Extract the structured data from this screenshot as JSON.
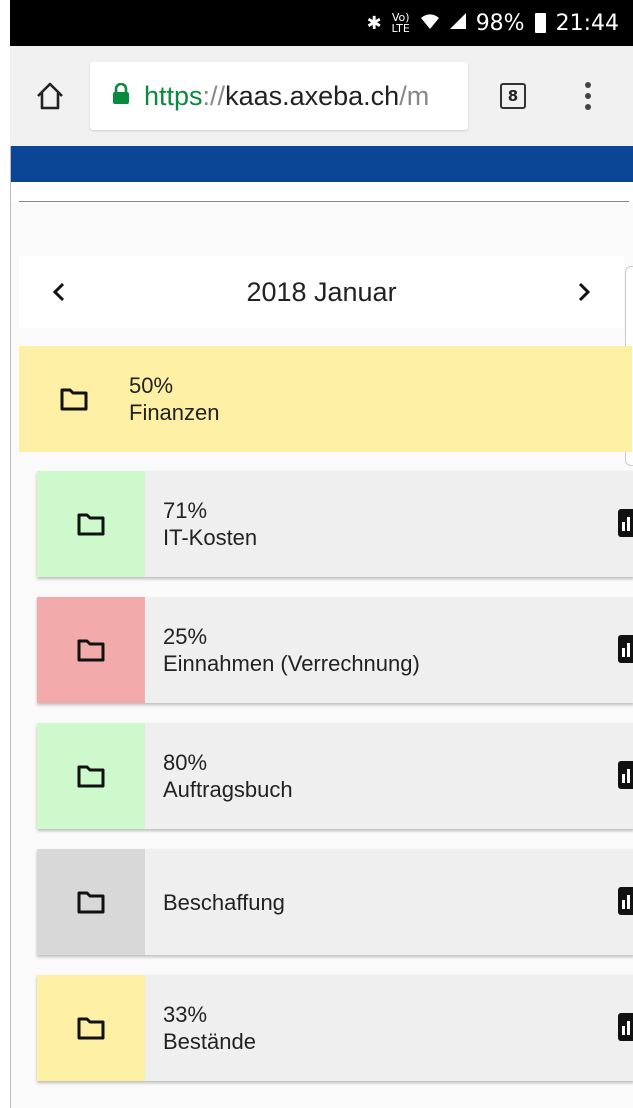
{
  "status_bar": {
    "bluetooth_icon": "bluetooth-icon",
    "volte": "Vo) LTE",
    "wifi_icon": "wifi-icon",
    "signal_icon": "signal-icon",
    "battery": "98%",
    "time": "21:44"
  },
  "browser": {
    "url_scheme": "https",
    "url_separator": "://",
    "url_host": "kaas.axeba.ch",
    "url_rest": "/m",
    "tab_count": "8",
    "home_icon": "home-icon",
    "lock_icon": "lock-icon",
    "menu_icon": "more-vert-icon"
  },
  "month_nav": {
    "label": "2018 Januar",
    "prev_icon": "chevron-left-icon",
    "next_icon": "chevron-right-icon"
  },
  "parent": {
    "percent": "50%",
    "name": "Finanzen",
    "color": "#fdf0a5"
  },
  "children": [
    {
      "percent": "71%",
      "name": "IT-Kosten",
      "color": "#cdf9cd"
    },
    {
      "percent": "25%",
      "name": "Einnahmen (Verrechnung)",
      "color": "#f3aaaa"
    },
    {
      "percent": "80%",
      "name": "Auftragsbuch",
      "color": "#cdf9cd"
    },
    {
      "percent": "",
      "name": "Beschaffung",
      "color": "#d8d8d8"
    },
    {
      "percent": "33%",
      "name": "Bestände",
      "color": "#fdf0a5"
    }
  ],
  "colors": {
    "header_blue": "#0a4596",
    "url_green": "#0a8a3c"
  }
}
